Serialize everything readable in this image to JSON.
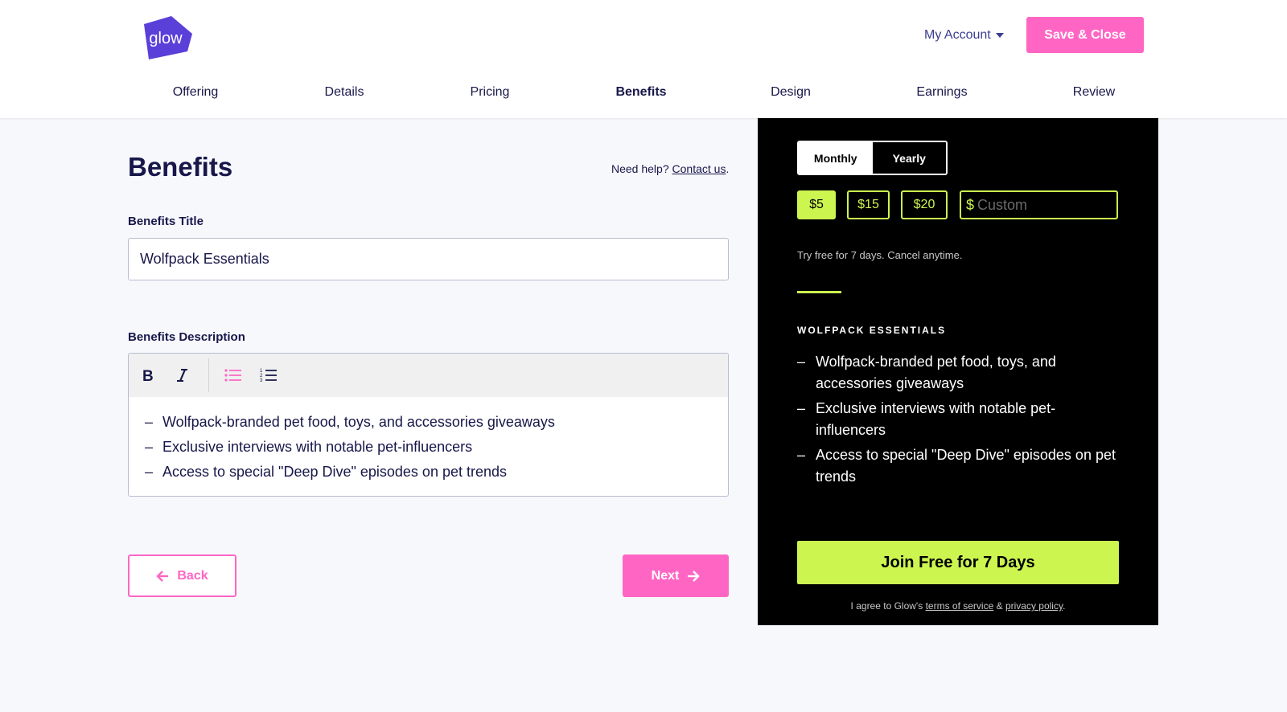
{
  "header": {
    "logo_text": "glow",
    "account_label": "My Account",
    "save_label": "Save & Close",
    "nav": [
      {
        "label": "Offering"
      },
      {
        "label": "Details"
      },
      {
        "label": "Pricing"
      },
      {
        "label": "Benefits",
        "active": true
      },
      {
        "label": "Design"
      },
      {
        "label": "Earnings"
      },
      {
        "label": "Review"
      }
    ]
  },
  "form": {
    "title": "Benefits",
    "help_prefix": "Need help?",
    "help_link": "Contact us",
    "help_suffix": ".",
    "benefits_title_label": "Benefits Title",
    "benefits_title_value": "Wolfpack Essentials",
    "benefits_desc_label": "Benefits Description",
    "toolbar": {
      "bold_icon": "bold-icon",
      "italic_icon": "italic-icon",
      "bullet_icon": "bullet-list-icon",
      "numbered_icon": "numbered-list-icon"
    },
    "items": [
      "Wolfpack-branded pet food, toys, and accessories giveaways",
      "Exclusive interviews with notable pet-influencers",
      "Access to special \"Deep Dive\" episodes on pet trends"
    ],
    "back_label": "Back",
    "next_label": "Next"
  },
  "preview": {
    "billing_options": [
      "Monthly",
      "Yearly"
    ],
    "prices": [
      "$5",
      "$15",
      "$20"
    ],
    "selected_price": "$5",
    "custom_currency": "$",
    "custom_placeholder": "Custom",
    "trial_note": "Try free for 7 days. Cancel anytime.",
    "benefits_heading": "WOLFPACK ESSENTIALS",
    "items": [
      "Wolfpack-branded pet food, toys, and accessories giveaways",
      "Exclusive interviews with notable pet-influencers",
      "Access to special \"Deep Dive\" episodes on pet trends"
    ],
    "join_label": "Join Free for 7 Days",
    "agree_prefix": "I agree to Glow's",
    "terms_link": "terms of service",
    "agree_and": "&",
    "privacy_link": "privacy policy",
    "agree_suffix": "."
  },
  "colors": {
    "accent_pink": "#ff66c4",
    "brand_purple": "#5b3fd9",
    "lime": "#ccf550",
    "navy_text": "#17174a"
  }
}
